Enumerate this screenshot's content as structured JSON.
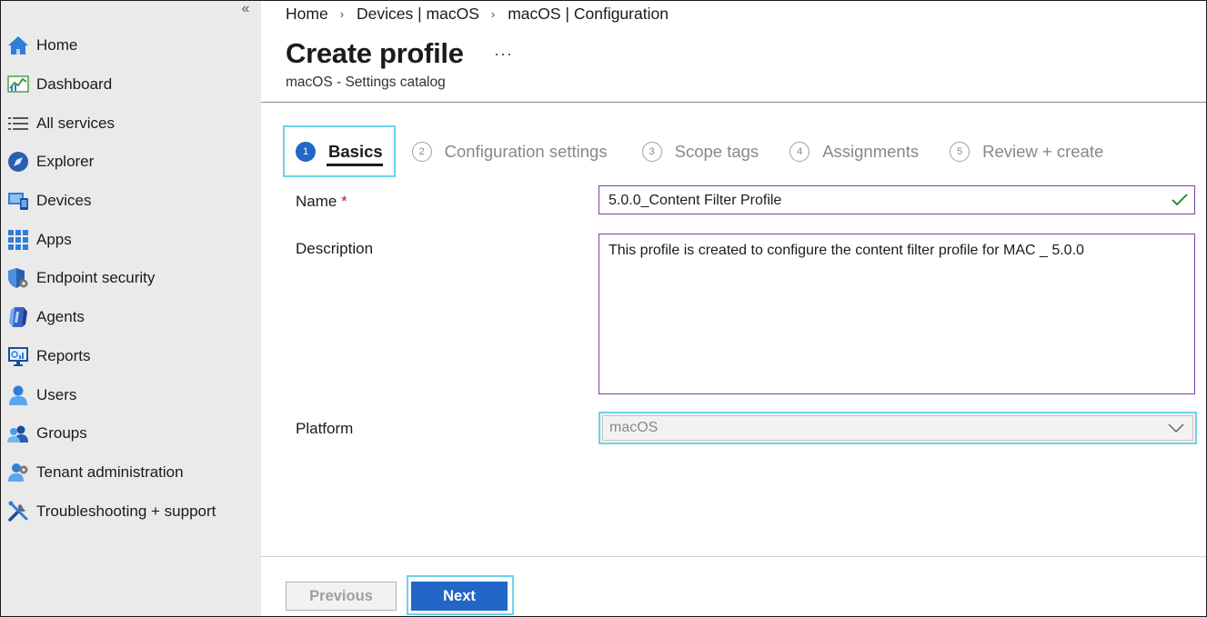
{
  "sidebar": {
    "collapse_label": "«",
    "items": [
      {
        "label": "Home",
        "icon": "home-icon"
      },
      {
        "label": "Dashboard",
        "icon": "dashboard-icon"
      },
      {
        "label": "All services",
        "icon": "list-icon"
      },
      {
        "label": "Explorer",
        "icon": "explorer-icon"
      },
      {
        "label": "Devices",
        "icon": "devices-icon"
      },
      {
        "label": "Apps",
        "icon": "apps-grid-icon"
      },
      {
        "label": "Endpoint security",
        "icon": "shield-gear-icon"
      },
      {
        "label": "Agents",
        "icon": "agents-icon"
      },
      {
        "label": "Reports",
        "icon": "reports-icon"
      },
      {
        "label": "Users",
        "icon": "user-icon"
      },
      {
        "label": "Groups",
        "icon": "groups-icon"
      },
      {
        "label": "Tenant administration",
        "icon": "tenant-admin-icon"
      },
      {
        "label": "Troubleshooting + support",
        "icon": "tools-icon"
      }
    ]
  },
  "breadcrumb": [
    "Home",
    "Devices | macOS",
    "macOS | Configuration"
  ],
  "breadcrumb_separator": "›",
  "header": {
    "title": "Create profile",
    "more_label": "···",
    "subtitle": "macOS - Settings catalog"
  },
  "steps": [
    {
      "number": "1",
      "label": "Basics",
      "active": true
    },
    {
      "number": "2",
      "label": "Configuration settings",
      "active": false
    },
    {
      "number": "3",
      "label": "Scope tags",
      "active": false
    },
    {
      "number": "4",
      "label": "Assignments",
      "active": false
    },
    {
      "number": "5",
      "label": "Review + create",
      "active": false
    }
  ],
  "form": {
    "name_label": "Name",
    "required_marker": "*",
    "name_value": "5.0.0_Content Filter Profile",
    "description_label": "Description",
    "description_value": "This profile is created to configure the content filter profile for MAC _ 5.0.0",
    "platform_label": "Platform",
    "platform_value": "macOS"
  },
  "footer": {
    "previous_label": "Previous",
    "next_label": "Next"
  },
  "colors": {
    "sidebar_bg": "#eaeaea",
    "primary": "#2266c7",
    "focus": "#6ad4ea",
    "input_border": "#7b3fa5",
    "valid_check": "#107c10"
  }
}
